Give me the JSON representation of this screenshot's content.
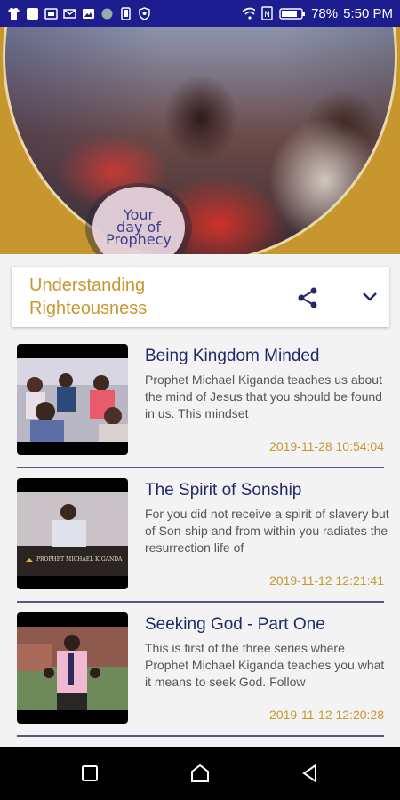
{
  "status_bar": {
    "battery": "78%",
    "time": "5:50 PM",
    "icons": [
      "tshirt-icon",
      "square-icon",
      "sim-icon",
      "mail-icon",
      "image-icon",
      "circle-icon",
      "phone-icon",
      "shield-icon",
      "wifi-icon",
      "nfc-icon",
      "battery-icon"
    ]
  },
  "hero": {
    "badge_line1": "Your",
    "badge_line2": "day of",
    "badge_line3": "Prophecy"
  },
  "selector": {
    "title": "Understanding Righteousness"
  },
  "videos": [
    {
      "title": "Being Kingdom Minded",
      "description": "Prophet Michael Kiganda teaches us about the mind of Jesus that you should be found in us. This mindset",
      "date": "2019-11-28 10:54:04"
    },
    {
      "title": "The Spirit of Sonship",
      "description": "For you did not receive a spirit of slavery but of Son-ship and from within you radiates the resurrection life of",
      "date": "2019-11-12 12:21:41",
      "thumb_caption": "PROPHET MICHAEL KIGANDA"
    },
    {
      "title": "Seeking God - Part One",
      "description": "This is first of the three series where Prophet Michael Kiganda teaches you what it means to seek God. Follow",
      "date": "2019-11-12 12:20:28"
    }
  ],
  "colors": {
    "status_bar": "#1d1d8f",
    "accent_gold": "#c9972f",
    "title_navy": "#1f2a6b"
  }
}
